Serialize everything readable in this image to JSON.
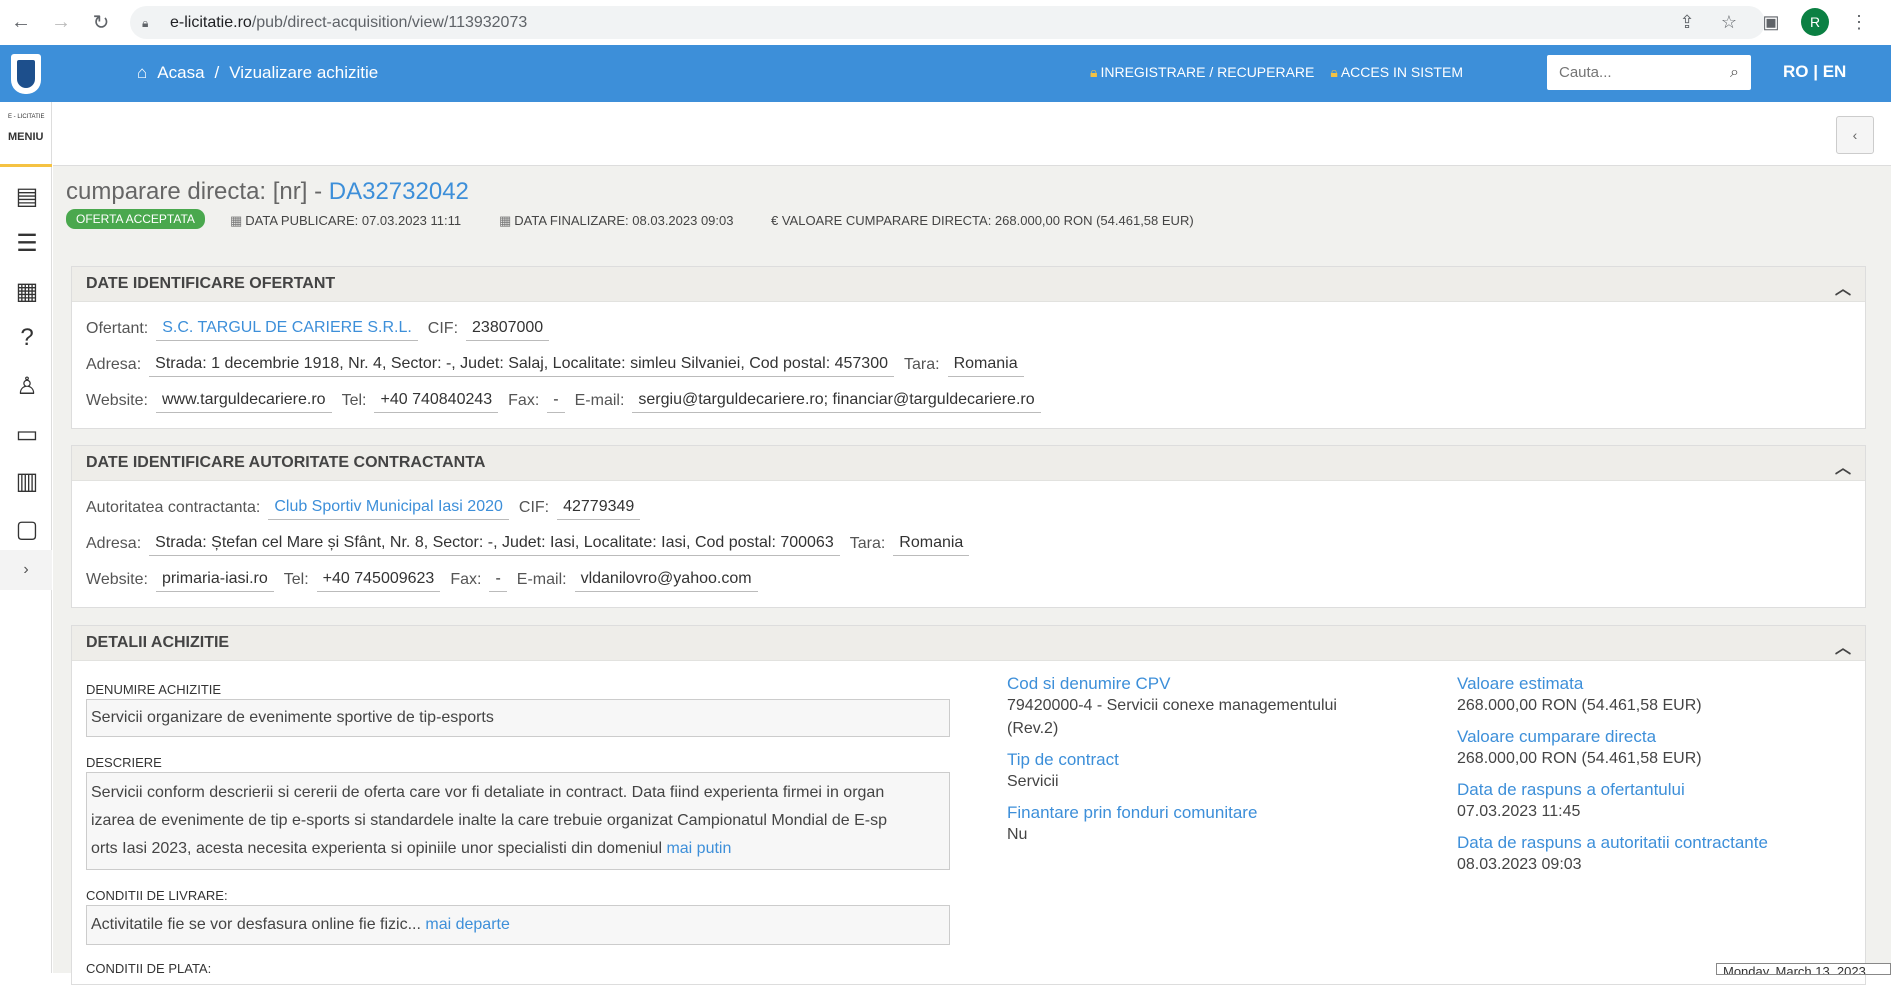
{
  "browser": {
    "url_host": "e-licitatie.ro",
    "url_path": "/pub/direct-acquisition/view/113932073",
    "profile_initial": "R"
  },
  "header": {
    "breadcrumb_home": "Acasa",
    "breadcrumb_sep": "/",
    "breadcrumb_current": "Vizualizare achizitie",
    "link_register": "INREGISTRARE / RECUPERARE",
    "link_login": "ACCES IN SISTEM",
    "search_placeholder": "Cauta...",
    "lang": "RO | EN"
  },
  "sidebar": {
    "brand": "E - LICITATIE",
    "menu_label": "MENIU",
    "expand": "›"
  },
  "page": {
    "title_prefix": "cumparare directa: [nr] - ",
    "title_number": "DA32732042",
    "status": "OFERTA ACCEPTATA",
    "data_publicare": "DATA PUBLICARE: 07.03.2023 11:11",
    "data_finalizare": "DATA FINALIZARE: 08.03.2023 09:03",
    "valoare": "€ VALOARE CUMPARARE DIRECTA: 268.000,00  RON (54.461,58  EUR)"
  },
  "ofertant": {
    "heading": "DATE IDENTIFICARE OFERTANT",
    "ofertant_label": "Ofertant:",
    "ofertant_name": "S.C. TARGUL DE CARIERE S.R.L.",
    "cif_label": "CIF:",
    "cif": "23807000",
    "adresa_label": "Adresa:",
    "adresa": "Strada: 1 decembrie 1918, Nr. 4, Sector: -, Judet: Salaj, Localitate: simleu Silvaniei, Cod postal: 457300",
    "tara_label": "Tara:",
    "tara": "Romania",
    "website_label": "Website:",
    "website": "www.targuldecariere.ro",
    "tel_label": "Tel:",
    "tel": "+40 740840243",
    "fax_label": "Fax:",
    "fax": "-",
    "email_label": "E-mail:",
    "email": "sergiu@targuldecariere.ro; financiar@targuldecariere.ro"
  },
  "autoritate": {
    "heading": "DATE IDENTIFICARE AUTORITATE CONTRACTANTA",
    "autoritate_label": "Autoritatea contractanta:",
    "autoritate_name": "Club Sportiv Municipal Iasi 2020",
    "cif_label": "CIF:",
    "cif": "42779349",
    "adresa_label": "Adresa:",
    "adresa": "Strada: Ștefan cel Mare și Sfânt, Nr. 8, Sector: -, Judet: Iasi, Localitate: Iasi, Cod postal: 700063",
    "tara_label": "Tara:",
    "tara": "Romania",
    "website_label": "Website:",
    "website": "primaria-iasi.ro",
    "tel_label": "Tel:",
    "tel": "+40 745009623",
    "fax_label": "Fax:",
    "fax": "-",
    "email_label": "E-mail:",
    "email": "vldanilovro@yahoo.com"
  },
  "detalii": {
    "heading": "DETALII ACHIZITIE",
    "denumire_label": "DENUMIRE ACHIZITIE",
    "denumire": "Servicii organizare de evenimente sportive de tip-esports",
    "descriere_label": "DESCRIERE",
    "descriere_line1": "Servicii conform descrierii si cererii de oferta care vor fi detaliate in contract. Data fiind experienta firmei in organ",
    "descriere_line2": "izarea de evenimente de tip e-sports si standardele inalte la care trebuie organizat Campionatul Mondial de E-sp",
    "descriere_line3": "orts Iasi 2023, acesta necesita experienta si opiniile unor specialisti din domeniul",
    "descriere_more": "mai putin",
    "conditii_livrare_label": "CONDITII DE LIVRARE:",
    "conditii_livrare": "Activitatile fie se vor desfasura online fie fizic...",
    "conditii_livrare_more": "mai departe",
    "conditii_plata_label": "CONDITII DE PLATA:",
    "cpv_title": "Cod si denumire CPV",
    "cpv_line1": "79420000-4 - Servicii conexe managementului",
    "cpv_line2": "(Rev.2)",
    "tip_contract_title": "Tip de contract",
    "tip_contract": "Servicii",
    "finantare_title": "Finantare prin fonduri comunitare",
    "finantare": "Nu",
    "valoare_estimata_title": "Valoare estimata",
    "valoare_estimata": "268.000,00  RON (54.461,58  EUR)",
    "valoare_directa_title": "Valoare cumparare directa",
    "valoare_directa": "268.000,00  RON (54.461,58  EUR)",
    "raspuns_ofertant_title": "Data de raspuns a ofertantului",
    "raspuns_ofertant": "07.03.2023 11:45",
    "raspuns_autoritate_title": "Data de raspuns a autoritatii contractante",
    "raspuns_autoritate": "08.03.2023 09:03"
  },
  "tooltip": "Monday, March 13, 2023"
}
